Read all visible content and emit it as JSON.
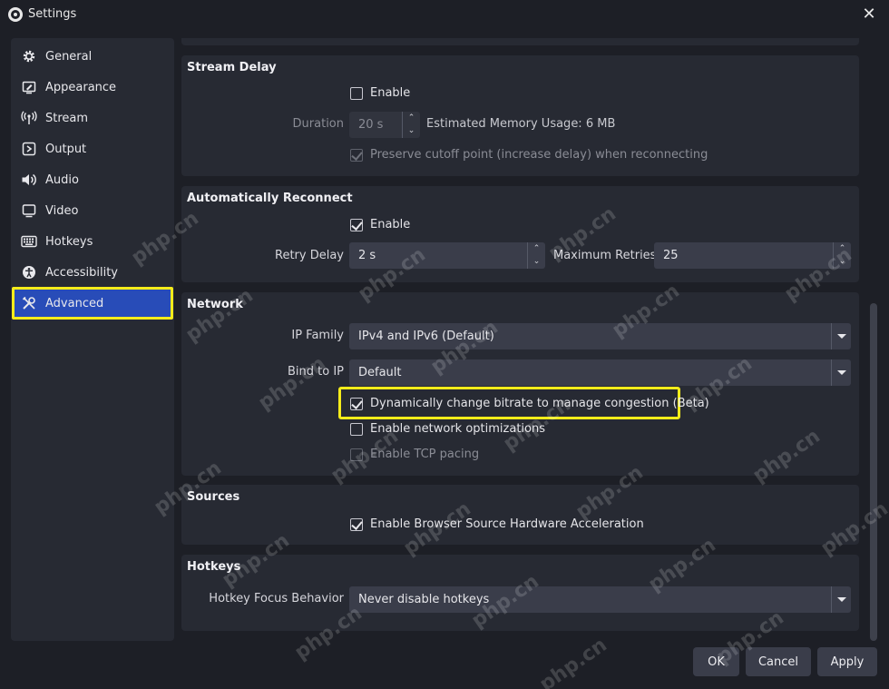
{
  "window": {
    "title": "Settings",
    "close": "✕"
  },
  "sidebar": {
    "items": [
      {
        "label": "General",
        "icon": "gear-icon"
      },
      {
        "label": "Appearance",
        "icon": "appearance-icon"
      },
      {
        "label": "Stream",
        "icon": "antenna-icon"
      },
      {
        "label": "Output",
        "icon": "output-icon"
      },
      {
        "label": "Audio",
        "icon": "speaker-icon"
      },
      {
        "label": "Video",
        "icon": "monitor-icon"
      },
      {
        "label": "Hotkeys",
        "icon": "keyboard-icon"
      },
      {
        "label": "Accessibility",
        "icon": "accessibility-icon"
      },
      {
        "label": "Advanced",
        "icon": "tools-icon",
        "active": true
      }
    ]
  },
  "stream_delay": {
    "title": "Stream Delay",
    "enable_label": "Enable",
    "enable_checked": false,
    "duration_label": "Duration",
    "duration_value": "20 s",
    "memory_text": "Estimated Memory Usage: 6 MB",
    "preserve_label": "Preserve cutoff point (increase delay) when reconnecting",
    "preserve_checked": true
  },
  "auto_reconnect": {
    "title": "Automatically Reconnect",
    "enable_label": "Enable",
    "enable_checked": true,
    "retry_delay_label": "Retry Delay",
    "retry_delay_value": "2 s",
    "max_retries_label": "Maximum Retries",
    "max_retries_value": "25"
  },
  "network": {
    "title": "Network",
    "ip_family_label": "IP Family",
    "ip_family_value": "IPv4 and IPv6 (Default)",
    "bind_label": "Bind to IP",
    "bind_value": "Default",
    "dyn_bitrate_label": "Dynamically change bitrate to manage congestion (Beta)",
    "dyn_bitrate_checked": true,
    "net_opt_label": "Enable network optimizations",
    "net_opt_checked": false,
    "tcp_pacing_label": "Enable TCP pacing",
    "tcp_pacing_checked": false
  },
  "sources": {
    "title": "Sources",
    "browser_accel_label": "Enable Browser Source Hardware Acceleration",
    "browser_accel_checked": true
  },
  "hotkeys": {
    "title": "Hotkeys",
    "focus_label": "Hotkey Focus Behavior",
    "focus_value": "Never disable hotkeys"
  },
  "buttons": {
    "ok": "OK",
    "cancel": "Cancel",
    "apply": "Apply"
  },
  "watermark": "php.cn",
  "colors": {
    "accent": "#284cb8",
    "highlight": "#f5ec1a",
    "panel": "#272a33",
    "background": "#1d1f26"
  }
}
